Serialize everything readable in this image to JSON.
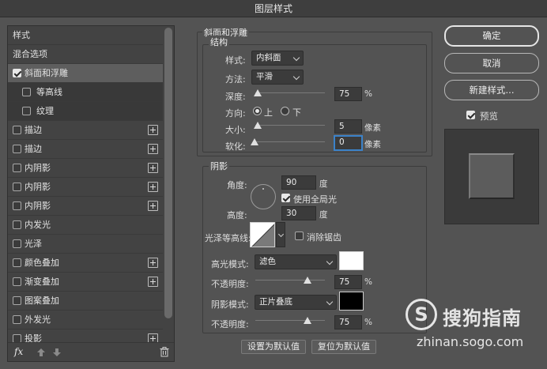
{
  "window": {
    "title": "图层样式"
  },
  "left_panel": {
    "items": [
      {
        "label": "样式",
        "checkbox": false,
        "plus": false
      },
      {
        "label": "混合选项",
        "checkbox": false,
        "plus": false
      },
      {
        "label": "斜面和浮雕",
        "checkbox": true,
        "checked": true,
        "plus": false,
        "selected": true
      },
      {
        "label": "等高线",
        "checkbox": true,
        "checked": false,
        "plus": false,
        "sub": true
      },
      {
        "label": "纹理",
        "checkbox": true,
        "checked": false,
        "plus": false,
        "sub": true
      },
      {
        "label": "描边",
        "checkbox": true,
        "checked": false,
        "plus": true
      },
      {
        "label": "描边",
        "checkbox": true,
        "checked": false,
        "plus": true
      },
      {
        "label": "内阴影",
        "checkbox": true,
        "checked": false,
        "plus": true
      },
      {
        "label": "内阴影",
        "checkbox": true,
        "checked": false,
        "plus": true
      },
      {
        "label": "内阴影",
        "checkbox": true,
        "checked": false,
        "plus": true
      },
      {
        "label": "内发光",
        "checkbox": true,
        "checked": false,
        "plus": false
      },
      {
        "label": "光泽",
        "checkbox": true,
        "checked": false,
        "plus": false
      },
      {
        "label": "颜色叠加",
        "checkbox": true,
        "checked": false,
        "plus": true
      },
      {
        "label": "渐变叠加",
        "checkbox": true,
        "checked": false,
        "plus": true
      },
      {
        "label": "图案叠加",
        "checkbox": true,
        "checked": false,
        "plus": false
      },
      {
        "label": "外发光",
        "checkbox": true,
        "checked": false,
        "plus": false
      },
      {
        "label": "投影",
        "checkbox": true,
        "checked": false,
        "plus": true
      }
    ],
    "footer": {
      "fx_label": "fx"
    }
  },
  "bevel": {
    "group_title": "斜面和浮雕",
    "structure_title": "结构",
    "style_label": "样式:",
    "style_value": "内斜面",
    "technique_label": "方法:",
    "technique_value": "平滑",
    "depth_label": "深度:",
    "depth_value": "75",
    "depth_unit": "%",
    "depth_level": 0.0,
    "direction_label": "方向:",
    "direction_up": "上",
    "direction_down": "下",
    "direction_selected": "up",
    "size_label": "大小:",
    "size_value": "5",
    "size_unit": "像素",
    "soften_label": "软化:",
    "soften_value": "0",
    "soften_unit": "像素"
  },
  "shading": {
    "title": "阴影",
    "angle_label": "角度:",
    "angle_value": "90",
    "angle_unit": "度",
    "global_light_label": "使用全局光",
    "global_light_checked": true,
    "altitude_label": "高度:",
    "altitude_value": "30",
    "altitude_unit": "度",
    "gloss_contour_label": "光泽等高线:",
    "anti_alias_label": "消除锯齿",
    "anti_alias_checked": false,
    "highlight_mode_label": "高光模式:",
    "highlight_mode_value": "滤色",
    "highlight_color": "#ffffff",
    "highlight_opacity_label": "不透明度:",
    "highlight_opacity_value": "75",
    "highlight_opacity_unit": "%",
    "shadow_mode_label": "阴影模式:",
    "shadow_mode_value": "正片叠底",
    "shadow_color": "#000000",
    "shadow_opacity_label": "不透明度:",
    "shadow_opacity_value": "75",
    "shadow_opacity_unit": "%"
  },
  "bottom_buttons": {
    "set_default": "设置为默认值",
    "reset_default": "复位为默认值"
  },
  "right_panel": {
    "ok": "确定",
    "cancel": "取消",
    "new_style": "新建样式...",
    "preview_label": "预览",
    "preview_checked": true
  },
  "watermark": {
    "brand": "搜狗指南",
    "url": "zhinan.sogo.com"
  }
}
